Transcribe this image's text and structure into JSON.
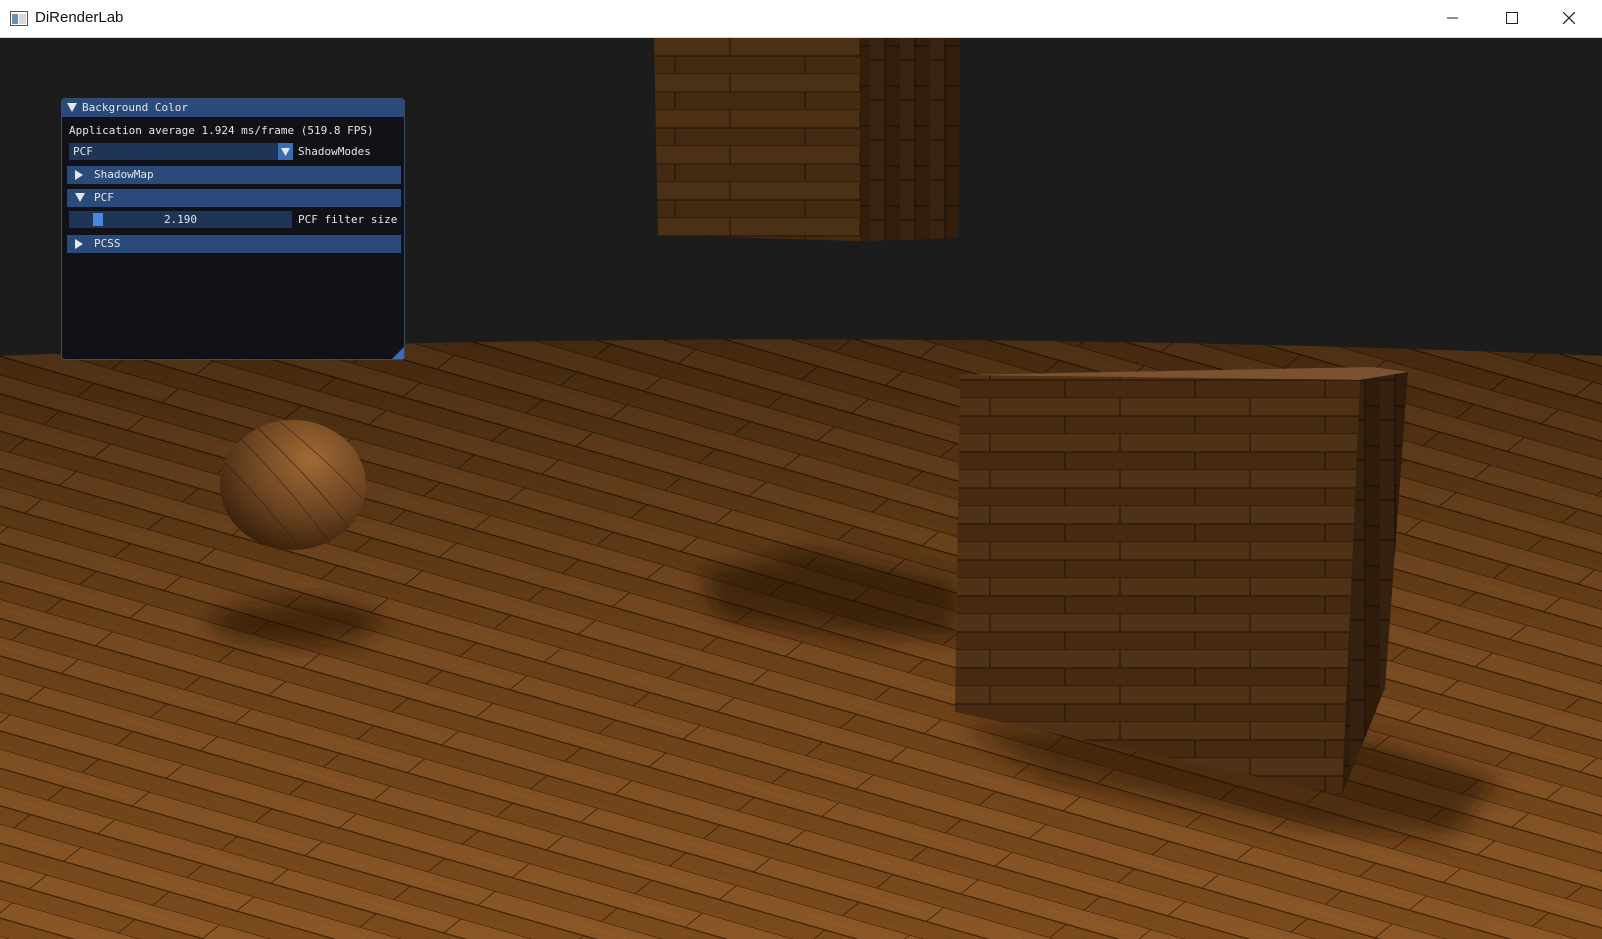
{
  "window": {
    "title": "DiRenderLab"
  },
  "colors": {
    "panel_bg": "#101218",
    "panel_title": "#294a7a",
    "header": "#2a4a7c",
    "frame": "#1e3557",
    "accent": "#4a86e0",
    "floor": "#7a4c1e",
    "wall": "#1c1c1c"
  },
  "imgui": {
    "title": "Background Color",
    "fps_text": "Application average 1.924 ms/frame (519.8 FPS)",
    "shadow_mode": {
      "value": "PCF",
      "label": "ShadowModes"
    },
    "sections": {
      "shadowmap": "ShadowMap",
      "pcf": "PCF",
      "pcss": "PCSS"
    },
    "pcf_slider": {
      "value": "2.190",
      "label": "PCF filter size"
    }
  },
  "icons": {
    "app": "app-window-icon",
    "minimize": "minimize-icon",
    "maximize": "maximize-icon",
    "close": "close-icon",
    "collapse": "triangle-down-icon",
    "expand": "triangle-right-icon"
  }
}
